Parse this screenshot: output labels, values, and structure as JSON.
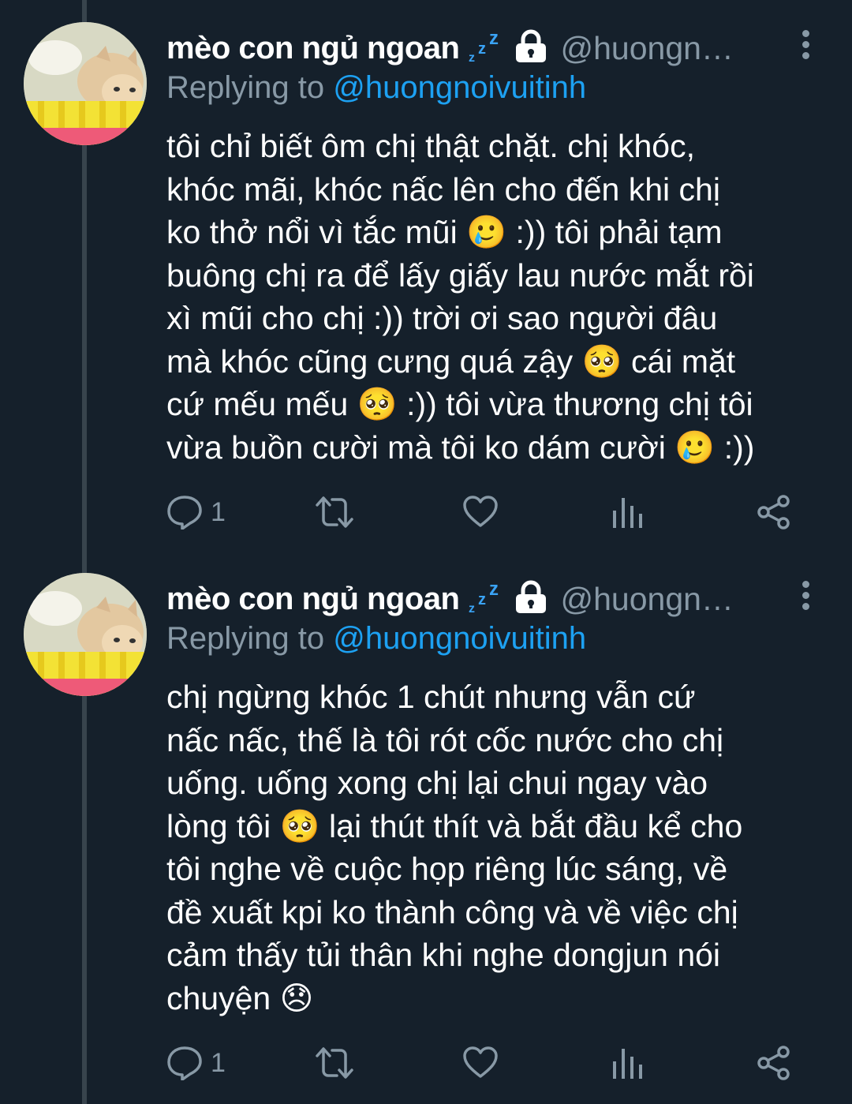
{
  "theme": {
    "background": "#15202b",
    "thread_line": "#38444d",
    "accent": "#1da1f2",
    "muted": "#8899a6"
  },
  "tweets": [
    {
      "author": {
        "display_name": "mèo con ngủ ngoan",
        "emoji": "zzz",
        "protected_icon": "lock-icon",
        "handle": "@huongn…"
      },
      "reply_prefix": "Replying to",
      "reply_to": "@huongnoivuitinh",
      "text": "tôi chỉ biết ôm chị thật chặt. chị khóc,\nkhóc mãi, khóc nấc lên cho đến khi chị\nko thở nổi vì tắc mũi 🥲 :)) tôi phải tạm\nbuông chị ra để lấy giấy lau nước mắt rồi\nxì mũi cho chị :)) trời ơi sao người đâu\nmà khóc cũng cưng quá zậy 🥺 cái mặt\ncứ mếu mếu 🥺 :)) tôi vừa thương chị tôi\nvừa buồn cười mà tôi ko dám cười 🥲 :))",
      "actions": {
        "reply_count": "1",
        "retweet_count": "",
        "like_count": ""
      }
    },
    {
      "author": {
        "display_name": "mèo con ngủ ngoan",
        "emoji": "zzz",
        "protected_icon": "lock-icon",
        "handle": "@huongn…"
      },
      "reply_prefix": "Replying to",
      "reply_to": "@huongnoivuitinh",
      "text": "chị ngừng khóc 1 chút nhưng vẫn cứ\nnấc nấc, thế là tôi rót cốc nước cho chị\nuống. uống xong chị lại chui ngay vào\nlòng tôi 🥺 lại thút thít và bắt đầu kể cho\ntôi nghe về cuộc họp riêng lúc sáng, về\nđề xuất kpi ko thành công và về việc chị\ncảm thấy tủi thân khi nghe dongjun nói\nchuyện 😞",
      "actions": {
        "reply_count": "1",
        "retweet_count": "",
        "like_count": ""
      }
    }
  ]
}
